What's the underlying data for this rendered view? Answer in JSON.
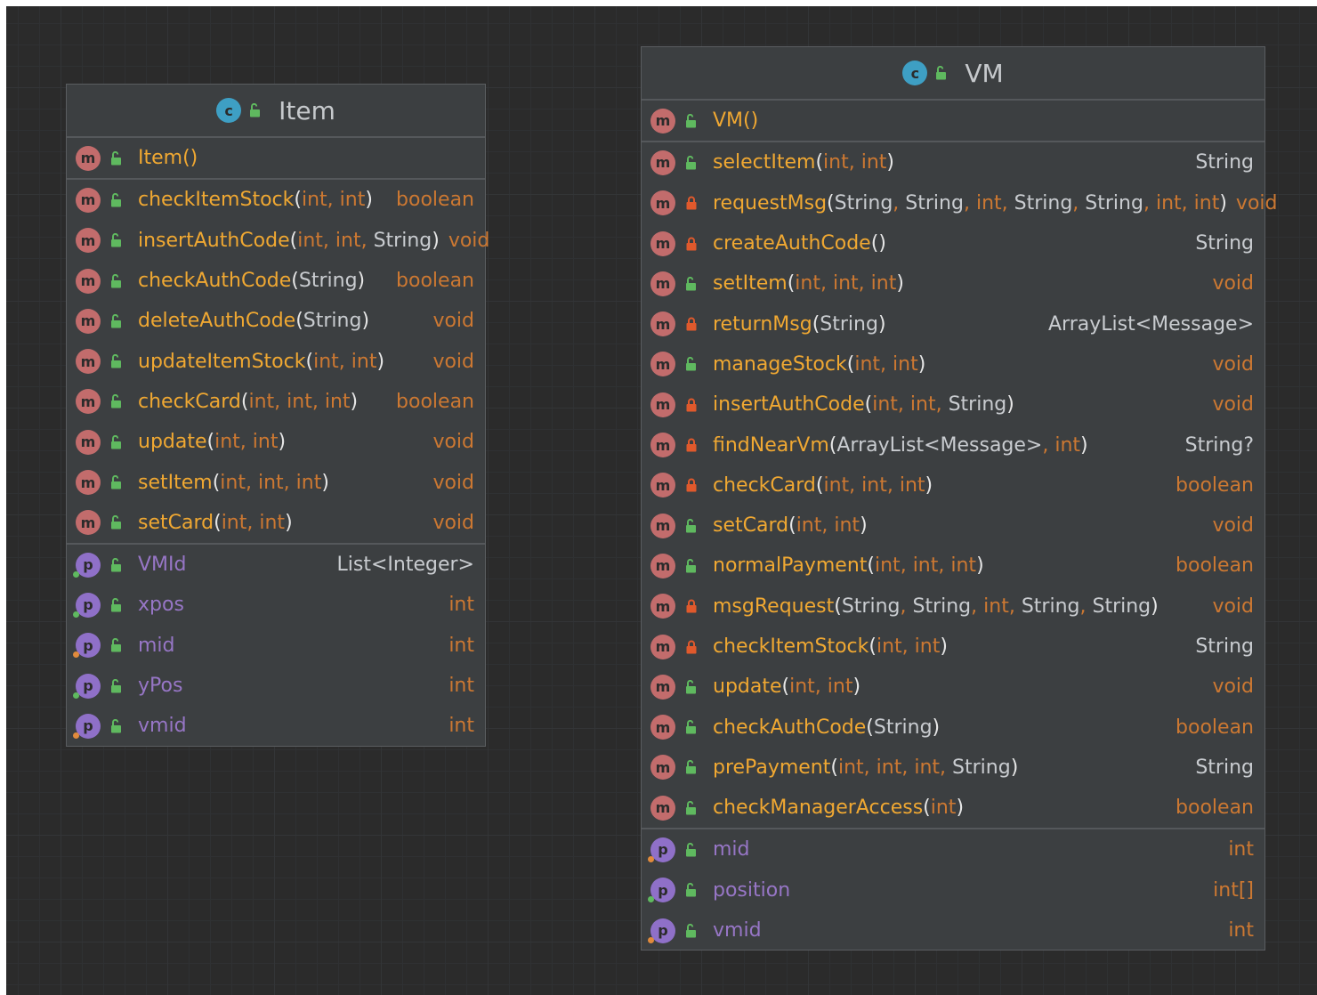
{
  "classes": [
    {
      "name": "Item",
      "type_icon": "class-icon",
      "constructor": {
        "name": "Item()",
        "visibility": "public"
      },
      "methods": [
        {
          "name": "checkItemStock",
          "params": "(int, int)",
          "return": "boolean",
          "return_kind": "prim",
          "visibility": "public"
        },
        {
          "name": "insertAuthCode",
          "params": "(int, int, String)",
          "return": "void",
          "return_kind": "prim",
          "visibility": "public"
        },
        {
          "name": "checkAuthCode",
          "params": "(String)",
          "return": "boolean",
          "return_kind": "prim",
          "visibility": "public"
        },
        {
          "name": "deleteAuthCode",
          "params": "(String)",
          "return": "void",
          "return_kind": "prim",
          "visibility": "public"
        },
        {
          "name": "updateItemStock",
          "params": "(int, int)",
          "return": "void",
          "return_kind": "prim",
          "visibility": "public"
        },
        {
          "name": "checkCard",
          "params": "(int, int, int)",
          "return": "boolean",
          "return_kind": "prim",
          "visibility": "public"
        },
        {
          "name": "update",
          "params": "(int, int)",
          "return": "void",
          "return_kind": "prim",
          "visibility": "public"
        },
        {
          "name": "setItem",
          "params": "(int, int, int)",
          "return": "void",
          "return_kind": "prim",
          "visibility": "public"
        },
        {
          "name": "setCard",
          "params": "(int, int)",
          "return": "void",
          "return_kind": "prim",
          "visibility": "public"
        }
      ],
      "fields": [
        {
          "name": "VMId",
          "type": "List<Integer>",
          "type_kind": "obj",
          "dot": "g"
        },
        {
          "name": "xpos",
          "type": "int",
          "type_kind": "prim",
          "dot": "g"
        },
        {
          "name": "mid",
          "type": "int",
          "type_kind": "prim",
          "dot": "o"
        },
        {
          "name": "yPos",
          "type": "int",
          "type_kind": "prim",
          "dot": "g"
        },
        {
          "name": "vmid",
          "type": "int",
          "type_kind": "prim",
          "dot": "o"
        }
      ]
    },
    {
      "name": "VM",
      "type_icon": "class-icon",
      "constructor": {
        "name": "VM()",
        "visibility": "public"
      },
      "methods": [
        {
          "name": "selectItem",
          "params": "(int, int)",
          "return": "String",
          "return_kind": "obj",
          "visibility": "public"
        },
        {
          "name": "requestMsg",
          "params": "(String, String, int, String, String, int, int)",
          "return": "void",
          "return_kind": "prim",
          "visibility": "private"
        },
        {
          "name": "createAuthCode",
          "params": "()",
          "return": "String",
          "return_kind": "obj",
          "visibility": "private"
        },
        {
          "name": "setItem",
          "params": "(int, int, int)",
          "return": "void",
          "return_kind": "prim",
          "visibility": "public"
        },
        {
          "name": "returnMsg",
          "params": "(String)",
          "return": "ArrayList<Message>",
          "return_kind": "obj",
          "visibility": "private"
        },
        {
          "name": "manageStock",
          "params": "(int, int)",
          "return": "void",
          "return_kind": "prim",
          "visibility": "public"
        },
        {
          "name": "insertAuthCode",
          "params": "(int, int, String)",
          "return": "void",
          "return_kind": "prim",
          "visibility": "private"
        },
        {
          "name": "findNearVm",
          "params": "(ArrayList<Message>, int)",
          "return": "String?",
          "return_kind": "obj",
          "visibility": "private"
        },
        {
          "name": "checkCard",
          "params": "(int, int, int)",
          "return": "boolean",
          "return_kind": "prim",
          "visibility": "private"
        },
        {
          "name": "setCard",
          "params": "(int, int)",
          "return": "void",
          "return_kind": "prim",
          "visibility": "public"
        },
        {
          "name": "normalPayment",
          "params": "(int, int, int)",
          "return": "boolean",
          "return_kind": "prim",
          "visibility": "public"
        },
        {
          "name": "msgRequest",
          "params": "(String, String, int, String, String)",
          "return": "void",
          "return_kind": "prim",
          "visibility": "private"
        },
        {
          "name": "checkItemStock",
          "params": "(int, int)",
          "return": "String",
          "return_kind": "obj",
          "visibility": "private"
        },
        {
          "name": "update",
          "params": "(int, int)",
          "return": "void",
          "return_kind": "prim",
          "visibility": "public"
        },
        {
          "name": "checkAuthCode",
          "params": "(String)",
          "return": "boolean",
          "return_kind": "prim",
          "visibility": "public"
        },
        {
          "name": "prePayment",
          "params": "(int, int, int, String)",
          "return": "String",
          "return_kind": "obj",
          "visibility": "public"
        },
        {
          "name": "checkManagerAccess",
          "params": "(int)",
          "return": "boolean",
          "return_kind": "prim",
          "visibility": "public"
        }
      ],
      "fields": [
        {
          "name": "mid",
          "type": "int",
          "type_kind": "prim",
          "dot": "o"
        },
        {
          "name": "position",
          "type": "int[]",
          "type_kind": "prim",
          "dot": "g"
        },
        {
          "name": "vmid",
          "type": "int",
          "type_kind": "prim",
          "dot": "o"
        }
      ]
    }
  ]
}
